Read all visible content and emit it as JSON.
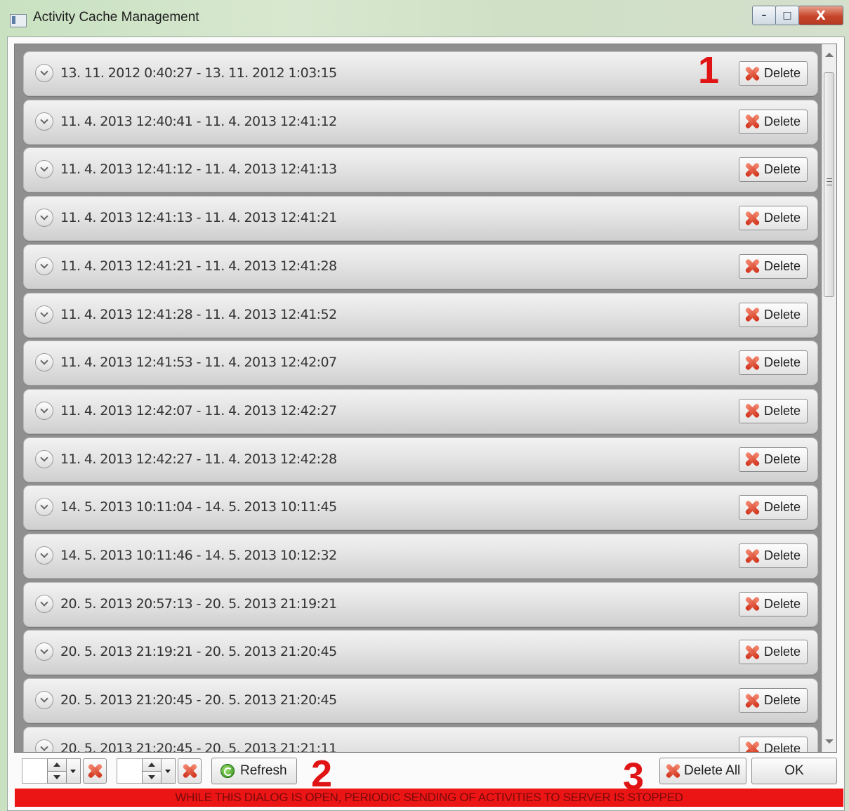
{
  "window": {
    "title": "Activity Cache Management",
    "minimize_glyph": "–",
    "maximize_glyph": "□",
    "close_glyph": "X"
  },
  "list": {
    "delete_label": "Delete",
    "items": [
      {
        "range": "13. 11. 2012 0:40:27 - 13. 11. 2012 1:03:15"
      },
      {
        "range": "11. 4. 2013 12:40:41 - 11. 4. 2013 12:41:12"
      },
      {
        "range": "11. 4. 2013 12:41:12 - 11. 4. 2013 12:41:13"
      },
      {
        "range": "11. 4. 2013 12:41:13 - 11. 4. 2013 12:41:21"
      },
      {
        "range": "11. 4. 2013 12:41:21 - 11. 4. 2013 12:41:28"
      },
      {
        "range": "11. 4. 2013 12:41:28 - 11. 4. 2013 12:41:52"
      },
      {
        "range": "11. 4. 2013 12:41:53 - 11. 4. 2013 12:42:07"
      },
      {
        "range": "11. 4. 2013 12:42:07 - 11. 4. 2013 12:42:27"
      },
      {
        "range": "11. 4. 2013 12:42:27 - 11. 4. 2013 12:42:28"
      },
      {
        "range": "14. 5. 2013 10:11:04 - 14. 5. 2013 10:11:45"
      },
      {
        "range": "14. 5. 2013 10:11:46 - 14. 5. 2013 10:12:32"
      },
      {
        "range": "20. 5. 2013 20:57:13 - 20. 5. 2013 21:19:21"
      },
      {
        "range": "20. 5. 2013 21:19:21 - 20. 5. 2013 21:20:45"
      },
      {
        "range": "20. 5. 2013 21:20:45 - 20. 5. 2013 21:20:45"
      },
      {
        "range": "20. 5. 2013 21:20:45 - 20. 5. 2013 21:21:11"
      }
    ]
  },
  "annotations": {
    "one": "1",
    "two": "2",
    "three": "3"
  },
  "toolbar": {
    "refresh_label": "Refresh",
    "delete_all_label": "Delete All",
    "ok_label": "OK"
  },
  "warning": "WHILE THIS DIALOG IS OPEN, PERIODIC SENDING OF ACTIVITIES TO SERVER IS STOPPED",
  "colors": {
    "warning_bg": "#ec1515",
    "annotation": "#e01414",
    "delete_icon": "#d1331c"
  }
}
